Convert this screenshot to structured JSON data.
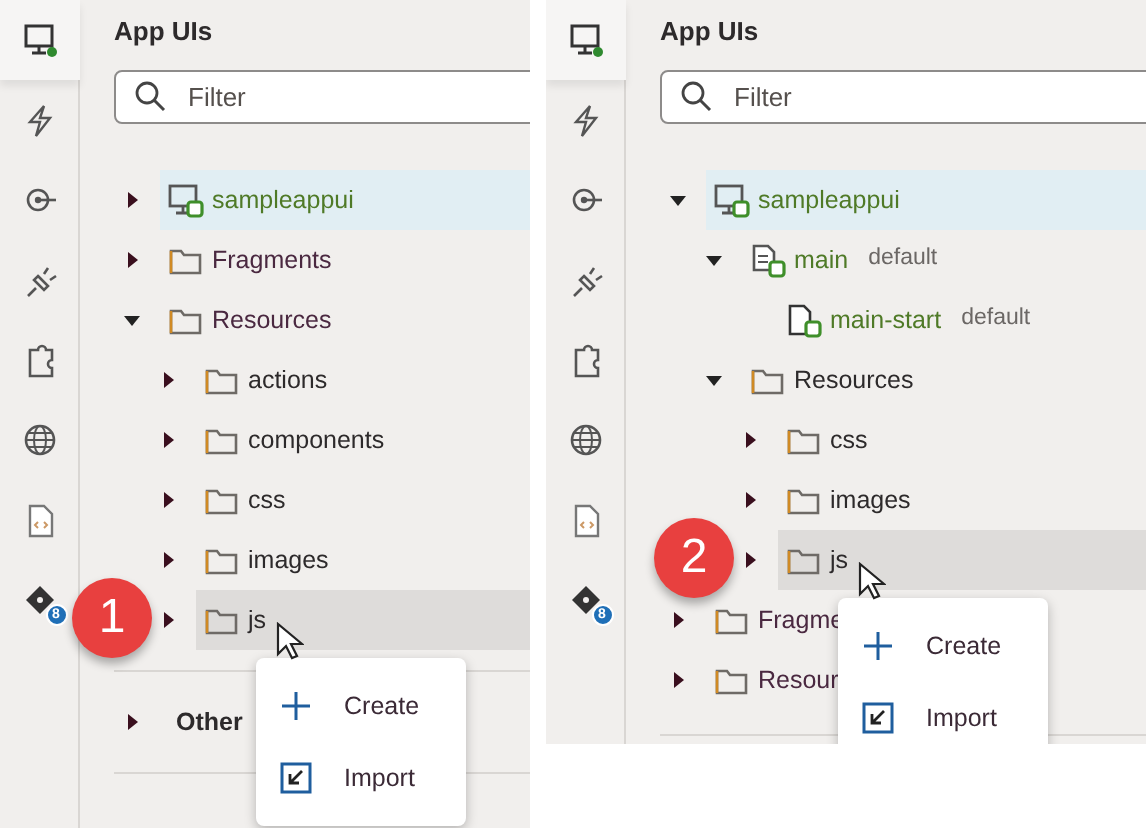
{
  "panels": [
    {
      "step": "1",
      "rail": [
        {
          "kind": "monitor",
          "selected": true
        },
        {
          "kind": "lightning",
          "selected": false
        },
        {
          "kind": "target",
          "selected": false
        },
        {
          "kind": "plug",
          "selected": false
        },
        {
          "kind": "puzzle",
          "selected": false
        },
        {
          "kind": "globe",
          "selected": false
        },
        {
          "kind": "file",
          "selected": false
        },
        {
          "kind": "tag",
          "selected": false,
          "count": "8"
        }
      ],
      "title": "App UIs",
      "filter": {
        "placeholder": "Filter"
      },
      "tree": [
        {
          "label": "sampleappui",
          "kind": "app",
          "expanded": false,
          "selected": true,
          "hovered": false
        },
        {
          "label": "Fragments",
          "kind": "folder",
          "expanded": false,
          "selected": false,
          "hovered": false
        },
        {
          "label": "Resources",
          "kind": "folder",
          "expanded": true,
          "selected": false,
          "hovered": false,
          "children": [
            {
              "label": "actions",
              "kind": "folder",
              "expanded": false,
              "selected": false,
              "hovered": false
            },
            {
              "label": "components",
              "kind": "folder",
              "expanded": false,
              "selected": false,
              "hovered": false
            },
            {
              "label": "css",
              "kind": "folder",
              "expanded": false,
              "selected": false,
              "hovered": false
            },
            {
              "label": "images",
              "kind": "folder",
              "expanded": false,
              "selected": false,
              "hovered": false
            },
            {
              "label": "js",
              "kind": "folder",
              "expanded": false,
              "selected": false,
              "hovered": true
            }
          ]
        }
      ],
      "sections": [
        {
          "label": "Other",
          "expanded": false
        }
      ],
      "menu": [
        {
          "label": "Create",
          "kind": "create"
        },
        {
          "label": "Import",
          "kind": "import"
        }
      ]
    },
    {
      "step": "2",
      "rail": [
        {
          "kind": "monitor",
          "selected": true
        },
        {
          "kind": "lightning",
          "selected": false
        },
        {
          "kind": "target",
          "selected": false
        },
        {
          "kind": "plug",
          "selected": false
        },
        {
          "kind": "puzzle",
          "selected": false
        },
        {
          "kind": "globe",
          "selected": false
        },
        {
          "kind": "file",
          "selected": false
        },
        {
          "kind": "tag",
          "selected": false,
          "count": "8"
        }
      ],
      "title": "App UIs",
      "filter": {
        "placeholder": "Filter"
      },
      "tree": [
        {
          "label": "sampleappui",
          "kind": "app",
          "expanded": true,
          "selected": true,
          "hovered": false,
          "children": [
            {
              "label": "main",
              "kind": "flow",
              "tag": "default",
              "expanded": true,
              "selected": false,
              "hovered": false,
              "children": [
                {
                  "label": "main-start",
                  "kind": "page",
                  "tag": "default",
                  "selected": false,
                  "hovered": false
                }
              ]
            },
            {
              "label": "Resources",
              "kind": "folder",
              "expanded": true,
              "selected": false,
              "hovered": false,
              "children": [
                {
                  "label": "css",
                  "kind": "folder",
                  "expanded": false,
                  "selected": false,
                  "hovered": false
                },
                {
                  "label": "images",
                  "kind": "folder",
                  "expanded": false,
                  "selected": false,
                  "hovered": false
                },
                {
                  "label": "js",
                  "kind": "folder",
                  "expanded": false,
                  "selected": false,
                  "hovered": true
                }
              ]
            }
          ]
        },
        {
          "label": "Fragme",
          "kind": "folder",
          "expanded": false,
          "selected": false,
          "hovered": false
        },
        {
          "label": "Resour",
          "kind": "folder",
          "expanded": false,
          "selected": false,
          "hovered": false
        }
      ],
      "menu": [
        {
          "label": "Create",
          "kind": "create"
        },
        {
          "label": "Import",
          "kind": "import"
        }
      ]
    }
  ]
}
